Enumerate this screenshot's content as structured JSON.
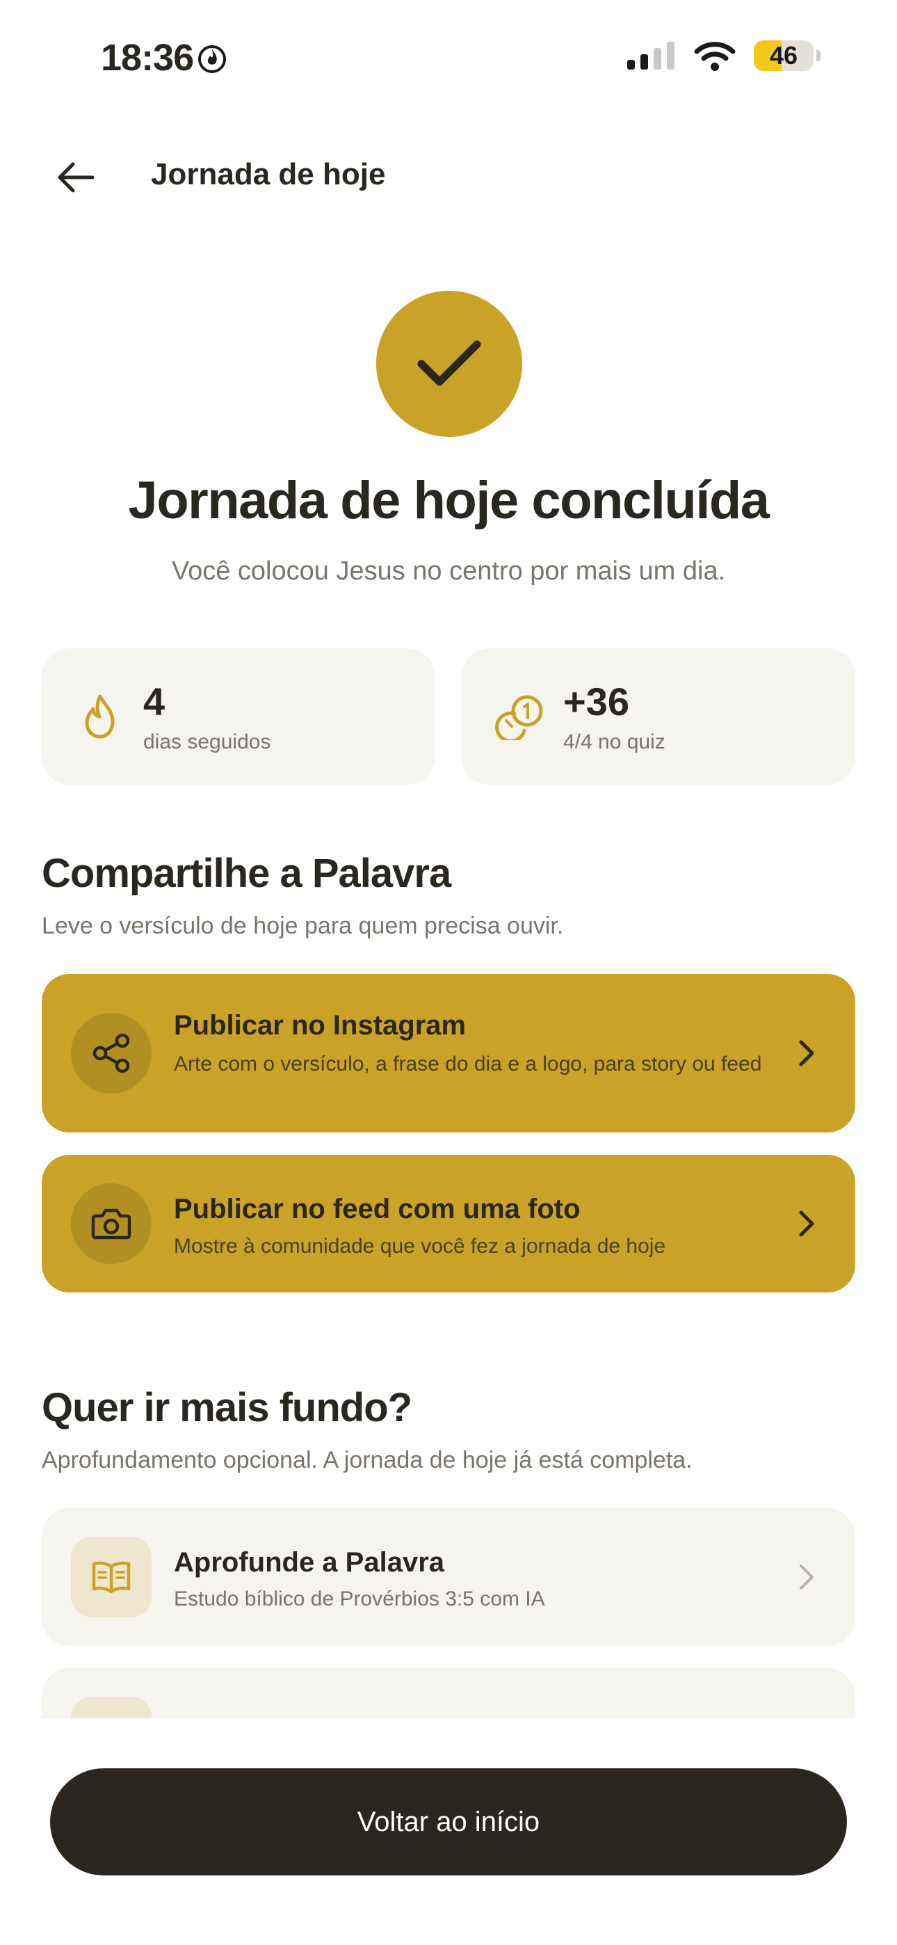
{
  "status_bar": {
    "time": "18:36",
    "battery": "46"
  },
  "header": {
    "title": "Jornada de hoje"
  },
  "hero": {
    "title": "Jornada de hoje concluída",
    "subtitle": "Você colocou Jesus no centro por mais um dia."
  },
  "stats": [
    {
      "value": "4",
      "label": "dias seguidos",
      "icon": "flame-icon"
    },
    {
      "value": "+36",
      "label": "4/4 no quiz",
      "icon": "coins-icon"
    }
  ],
  "share": {
    "title": "Compartilhe a Palavra",
    "subtitle": "Leve o versículo de hoje para quem precisa ouvir.",
    "cards": [
      {
        "title": "Publicar no Instagram",
        "description": "Arte com o versículo, a frase do dia e a logo, para story ou feed",
        "icon": "share-icon"
      },
      {
        "title": "Publicar no feed com uma foto",
        "description": "Mostre à comunidade que você fez a jornada de hoje",
        "icon": "camera-icon"
      }
    ]
  },
  "deeper": {
    "title": "Quer ir mais fundo?",
    "subtitle": "Aprofundamento opcional. A jornada de hoje já está completa.",
    "cards": [
      {
        "title": "Aprofunde a Palavra",
        "description": "Estudo bíblico de Provérbios 3:5 com IA",
        "icon": "book-icon"
      }
    ]
  },
  "cta": {
    "label": "Voltar ao início"
  },
  "colors": {
    "gold": "#c9a227",
    "dark": "#2b2620",
    "card": "#f6f4ef",
    "muted": "#7a756c"
  }
}
